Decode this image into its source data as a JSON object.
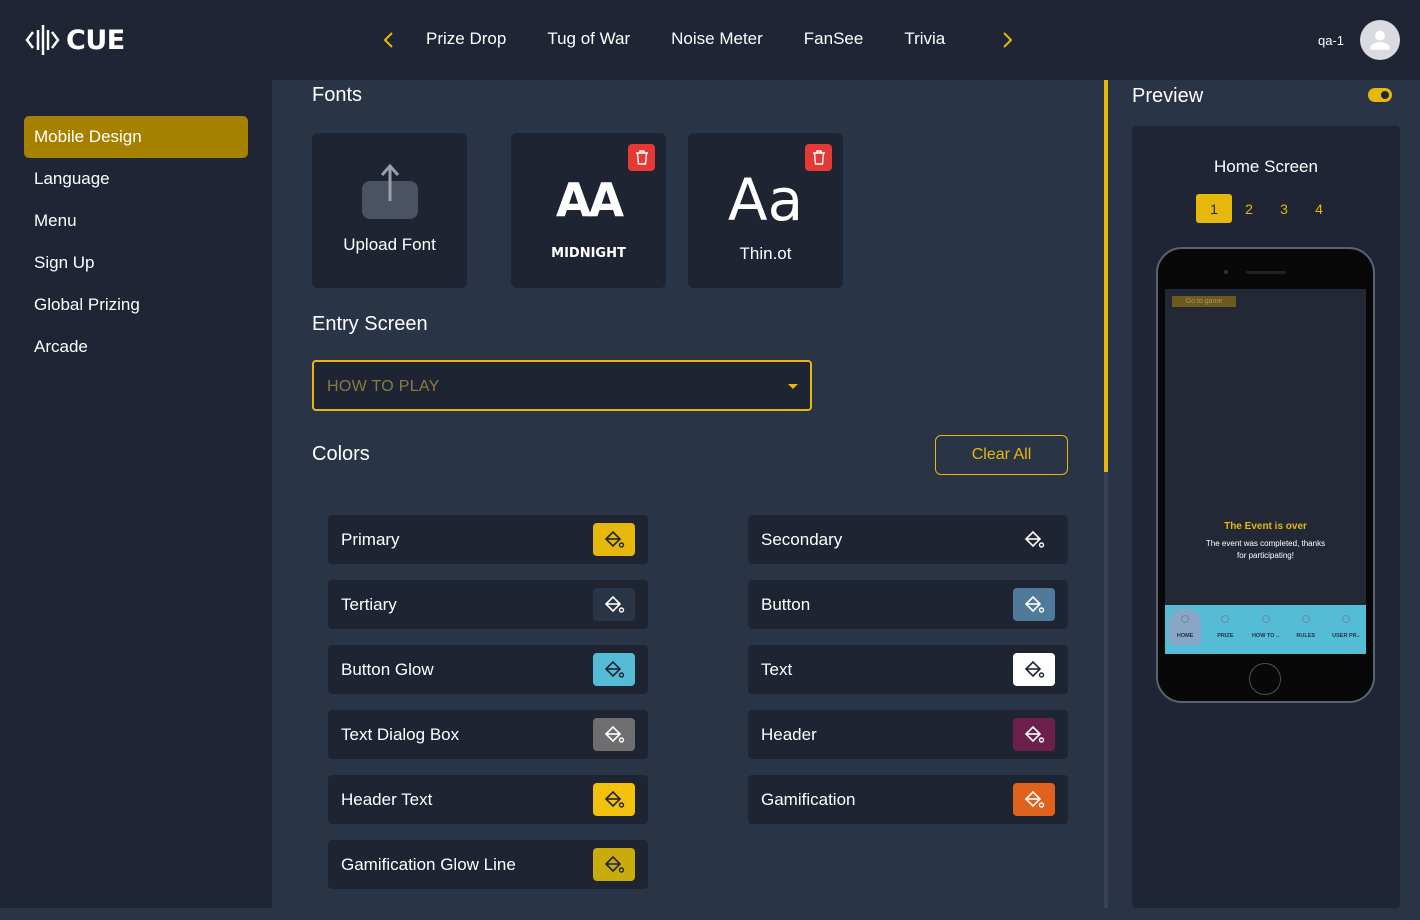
{
  "app": {
    "logo_text": "CUE"
  },
  "topnav": {
    "tabs": [
      "Prize Drop",
      "Tug of War",
      "Noise Meter",
      "FanSee",
      "Trivia"
    ],
    "prev_icon": "chevron-left-icon",
    "next_icon": "chevron-right-icon"
  },
  "user": {
    "name": "qa-1",
    "avatar_icon": "user-avatar-icon"
  },
  "sidebar": {
    "items": [
      {
        "label": "Mobile Design",
        "active": true
      },
      {
        "label": "Language"
      },
      {
        "label": "Menu"
      },
      {
        "label": "Sign Up"
      },
      {
        "label": "Global Prizing"
      },
      {
        "label": "Arcade"
      }
    ]
  },
  "fonts": {
    "title": "Fonts",
    "upload_label": "Upload Font",
    "cards": [
      {
        "sample": "AA",
        "name": "MIDNIGHT"
      },
      {
        "sample": "Aa",
        "name": "Thin.ot"
      }
    ]
  },
  "entry_screen": {
    "title": "Entry Screen",
    "selected": "HOW TO PLAY"
  },
  "colors": {
    "title": "Colors",
    "clear_all": "Clear All",
    "items": [
      {
        "label": "Primary",
        "color": "#e6b80b"
      },
      {
        "label": "Secondary",
        "color": "#1e2432"
      },
      {
        "label": "Tertiary",
        "color": "#2a3447"
      },
      {
        "label": "Button",
        "color": "#4f7a99"
      },
      {
        "label": "Button Glow",
        "color": "#55bcd6"
      },
      {
        "label": "Text",
        "color": "#ffffff"
      },
      {
        "label": "Text Dialog Box",
        "color": "#6e6e6e"
      },
      {
        "label": "Header",
        "color": "#6b1f4a"
      },
      {
        "label": "Header Text",
        "color": "#f2c10c"
      },
      {
        "label": "Gamification",
        "color": "#e0621c"
      },
      {
        "label": "Gamification Glow Line",
        "color": "#c9ab0c"
      }
    ]
  },
  "preview": {
    "title": "Preview",
    "toggle_on": true,
    "screen_title": "Home Screen",
    "pages": [
      "1",
      "2",
      "3",
      "4"
    ],
    "active_page": "1",
    "phone": {
      "go_button": "Go to game",
      "event_title": "The Event is over",
      "event_text": "The event was completed, thanks for participating!",
      "nav_items": [
        "HOME",
        "PRIZE",
        "HOW TO ..",
        "RULES",
        "USER PR.."
      ]
    }
  }
}
